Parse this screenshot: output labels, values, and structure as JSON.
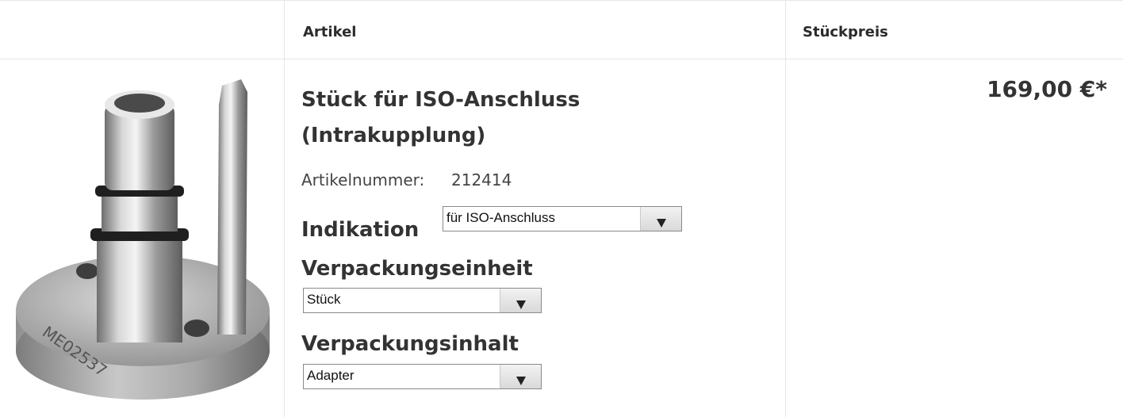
{
  "table_header": {
    "article": "Artikel",
    "unit_price": "Stückpreis"
  },
  "product": {
    "title": "Stück für ISO-Anschluss (Intrakupplung)",
    "article_number_label": "Artikelnummer:",
    "article_number": "212414",
    "image_engraving": "ME02537",
    "price": "169,00 €*"
  },
  "options": {
    "indication_label": "Indikation",
    "indication_value": "für ISO-Anschluss",
    "packaging_unit_label": "Verpackungseinheit",
    "packaging_unit_value": "Stück",
    "packaging_content_label": "Verpackungsinhalt",
    "packaging_content_value": "Adapter"
  }
}
